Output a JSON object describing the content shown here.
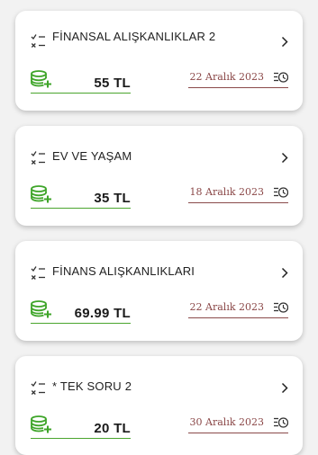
{
  "colors": {
    "price_underline": "#4aa52e",
    "coin_icon": "#3fa52a",
    "date_text": "#8a4747",
    "date_underline": "#8a4a4a"
  },
  "cards": [
    {
      "title": "FİNANSAL ALIŞKANLIKLAR 2",
      "price": "55 TL",
      "date": "22 Aralık 2023"
    },
    {
      "title": "EV VE YAŞAM",
      "price": "35 TL",
      "date": "18 Aralık 2023"
    },
    {
      "title": "FİNANS ALIŞKANLIKLARI",
      "price": "69.99 TL",
      "date": "22 Aralık 2023"
    },
    {
      "title": "* TEK SORU 2",
      "price": "20 TL",
      "date": "30 Aralık 2023"
    }
  ],
  "icons": {
    "quiz": "checklist-icon",
    "chevron": "chevron-right-icon",
    "coin": "coin-stack-add-icon",
    "schedule": "schedule-clock-icon"
  }
}
